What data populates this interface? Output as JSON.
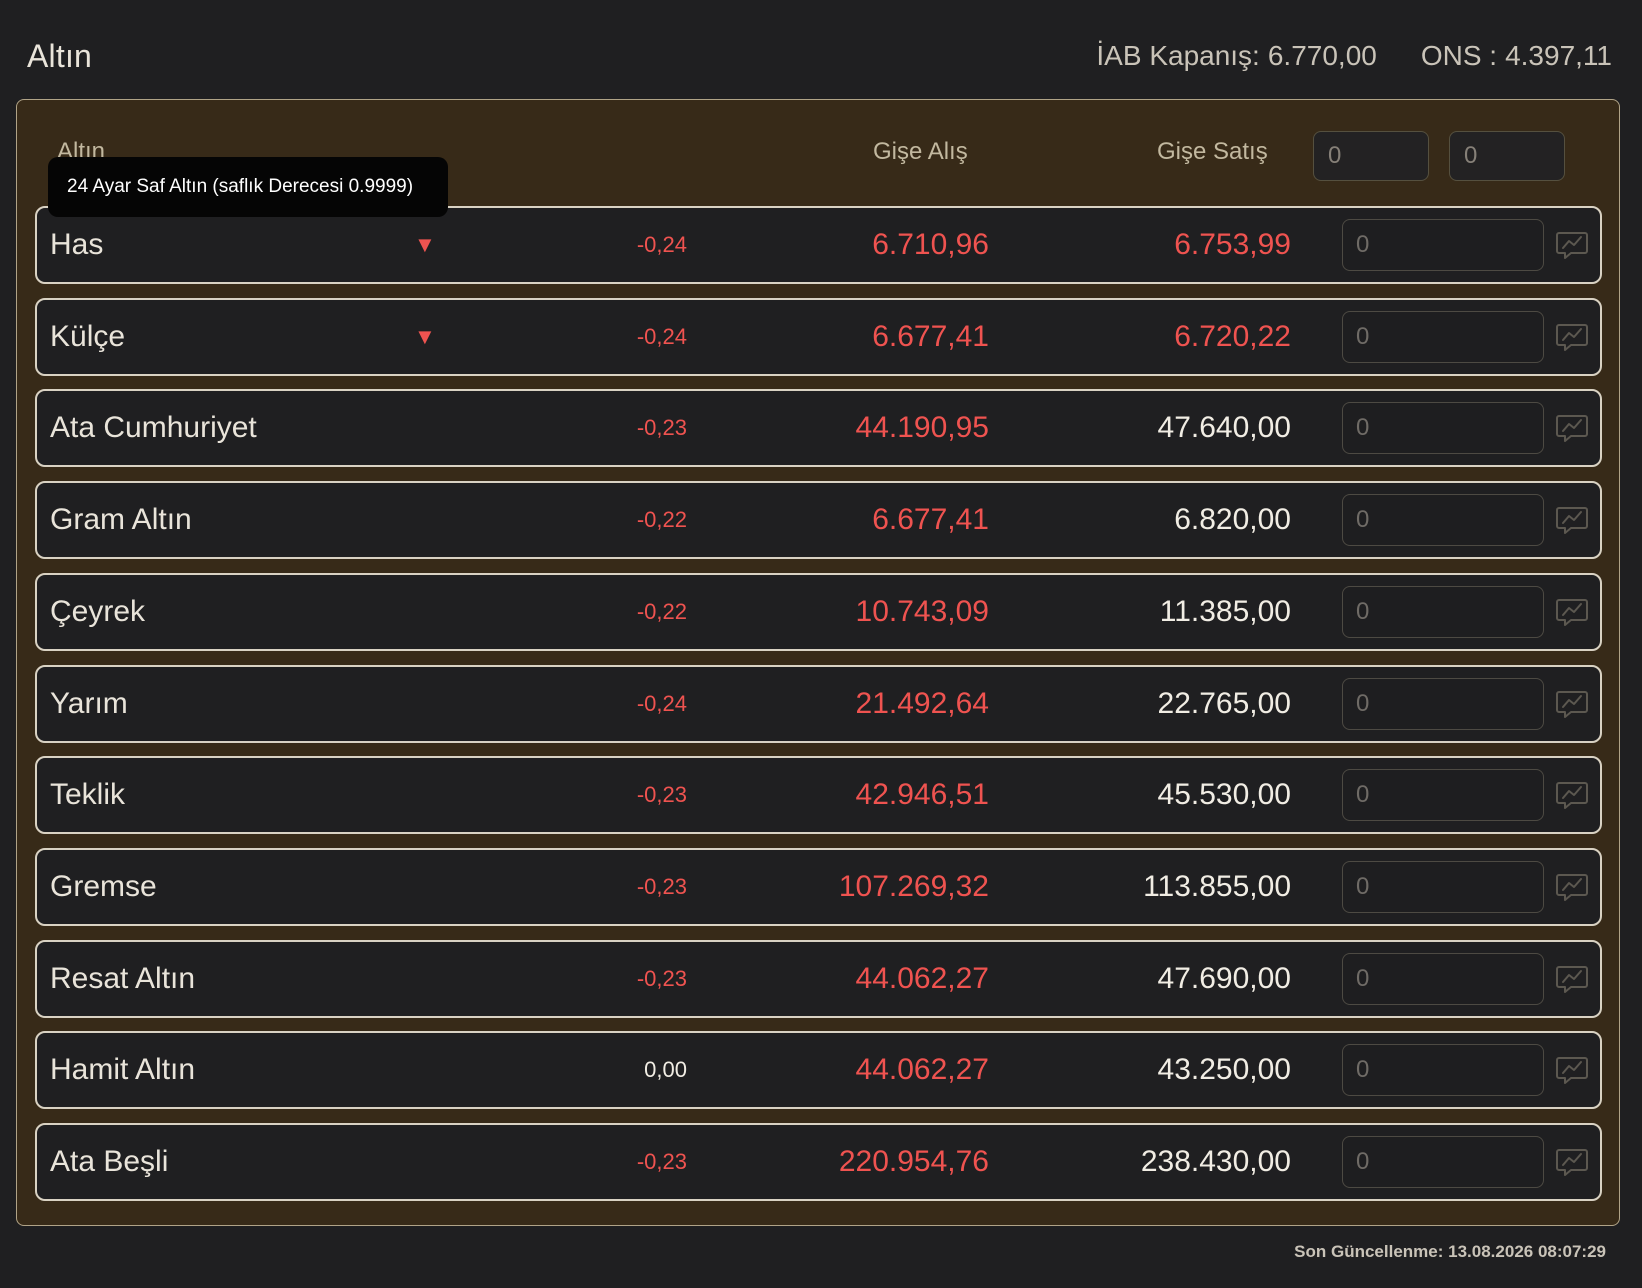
{
  "header": {
    "title": "Altın",
    "iab_label": "İAB Kapanış:",
    "iab_value": "6.770,00",
    "ons_label": "ONS :",
    "ons_value": "4.397,11"
  },
  "table": {
    "col_name": "Altın",
    "col_buy": "Gişe Alış",
    "col_sell": "Gişe Satış",
    "head_input_1": "0",
    "head_input_2": "0",
    "tooltip": "24 Ayar Saf Altın (saflık Derecesi 0.9999)"
  },
  "rows": [
    {
      "name": "Has",
      "arrow": "▼",
      "change": "-0,24",
      "change_color": "red",
      "buy": "6.710,96",
      "buy_color": "red",
      "sell": "6.753,99",
      "sell_color": "red",
      "input": "0"
    },
    {
      "name": "Külçe",
      "arrow": "▼",
      "change": "-0,24",
      "change_color": "red",
      "buy": "6.677,41",
      "buy_color": "red",
      "sell": "6.720,22",
      "sell_color": "red",
      "input": "0"
    },
    {
      "name": "Ata Cumhuriyet",
      "arrow": "",
      "change": "-0,23",
      "change_color": "red",
      "buy": "44.190,95",
      "buy_color": "red",
      "sell": "47.640,00",
      "sell_color": "white",
      "input": "0"
    },
    {
      "name": "Gram Altın",
      "arrow": "",
      "change": "-0,22",
      "change_color": "red",
      "buy": "6.677,41",
      "buy_color": "red",
      "sell": "6.820,00",
      "sell_color": "white",
      "input": "0"
    },
    {
      "name": "Çeyrek",
      "arrow": "",
      "change": "-0,22",
      "change_color": "red",
      "buy": "10.743,09",
      "buy_color": "red",
      "sell": "11.385,00",
      "sell_color": "white",
      "input": "0"
    },
    {
      "name": "Yarım",
      "arrow": "",
      "change": "-0,24",
      "change_color": "red",
      "buy": "21.492,64",
      "buy_color": "red",
      "sell": "22.765,00",
      "sell_color": "white",
      "input": "0"
    },
    {
      "name": "Teklik",
      "arrow": "",
      "change": "-0,23",
      "change_color": "red",
      "buy": "42.946,51",
      "buy_color": "red",
      "sell": "45.530,00",
      "sell_color": "white",
      "input": "0"
    },
    {
      "name": "Gremse",
      "arrow": "",
      "change": "-0,23",
      "change_color": "red",
      "buy": "107.269,32",
      "buy_color": "red",
      "sell": "113.855,00",
      "sell_color": "white",
      "input": "0"
    },
    {
      "name": "Resat Altın",
      "arrow": "",
      "change": "-0,23",
      "change_color": "red",
      "buy": "44.062,27",
      "buy_color": "red",
      "sell": "47.690,00",
      "sell_color": "white",
      "input": "0"
    },
    {
      "name": "Hamit Altın",
      "arrow": "",
      "change": "0,00",
      "change_color": "white",
      "buy": "44.062,27",
      "buy_color": "red",
      "sell": "43.250,00",
      "sell_color": "white",
      "input": "0"
    },
    {
      "name": "Ata Beşli",
      "arrow": "",
      "change": "-0,23",
      "change_color": "red",
      "buy": "220.954,76",
      "buy_color": "red",
      "sell": "238.430,00",
      "sell_color": "white",
      "input": "0"
    }
  ],
  "footer": {
    "label": "Son Güncellenme:",
    "value": "13.08.2026 08:07:29"
  },
  "colors": {
    "background": "#1f1f21",
    "panel": "#372a18",
    "negative": "#ef5350",
    "text": "#f1ede4"
  },
  "icons": {
    "row_chart": "chart-line-icon",
    "row_arrow": "triangle-down-icon"
  }
}
